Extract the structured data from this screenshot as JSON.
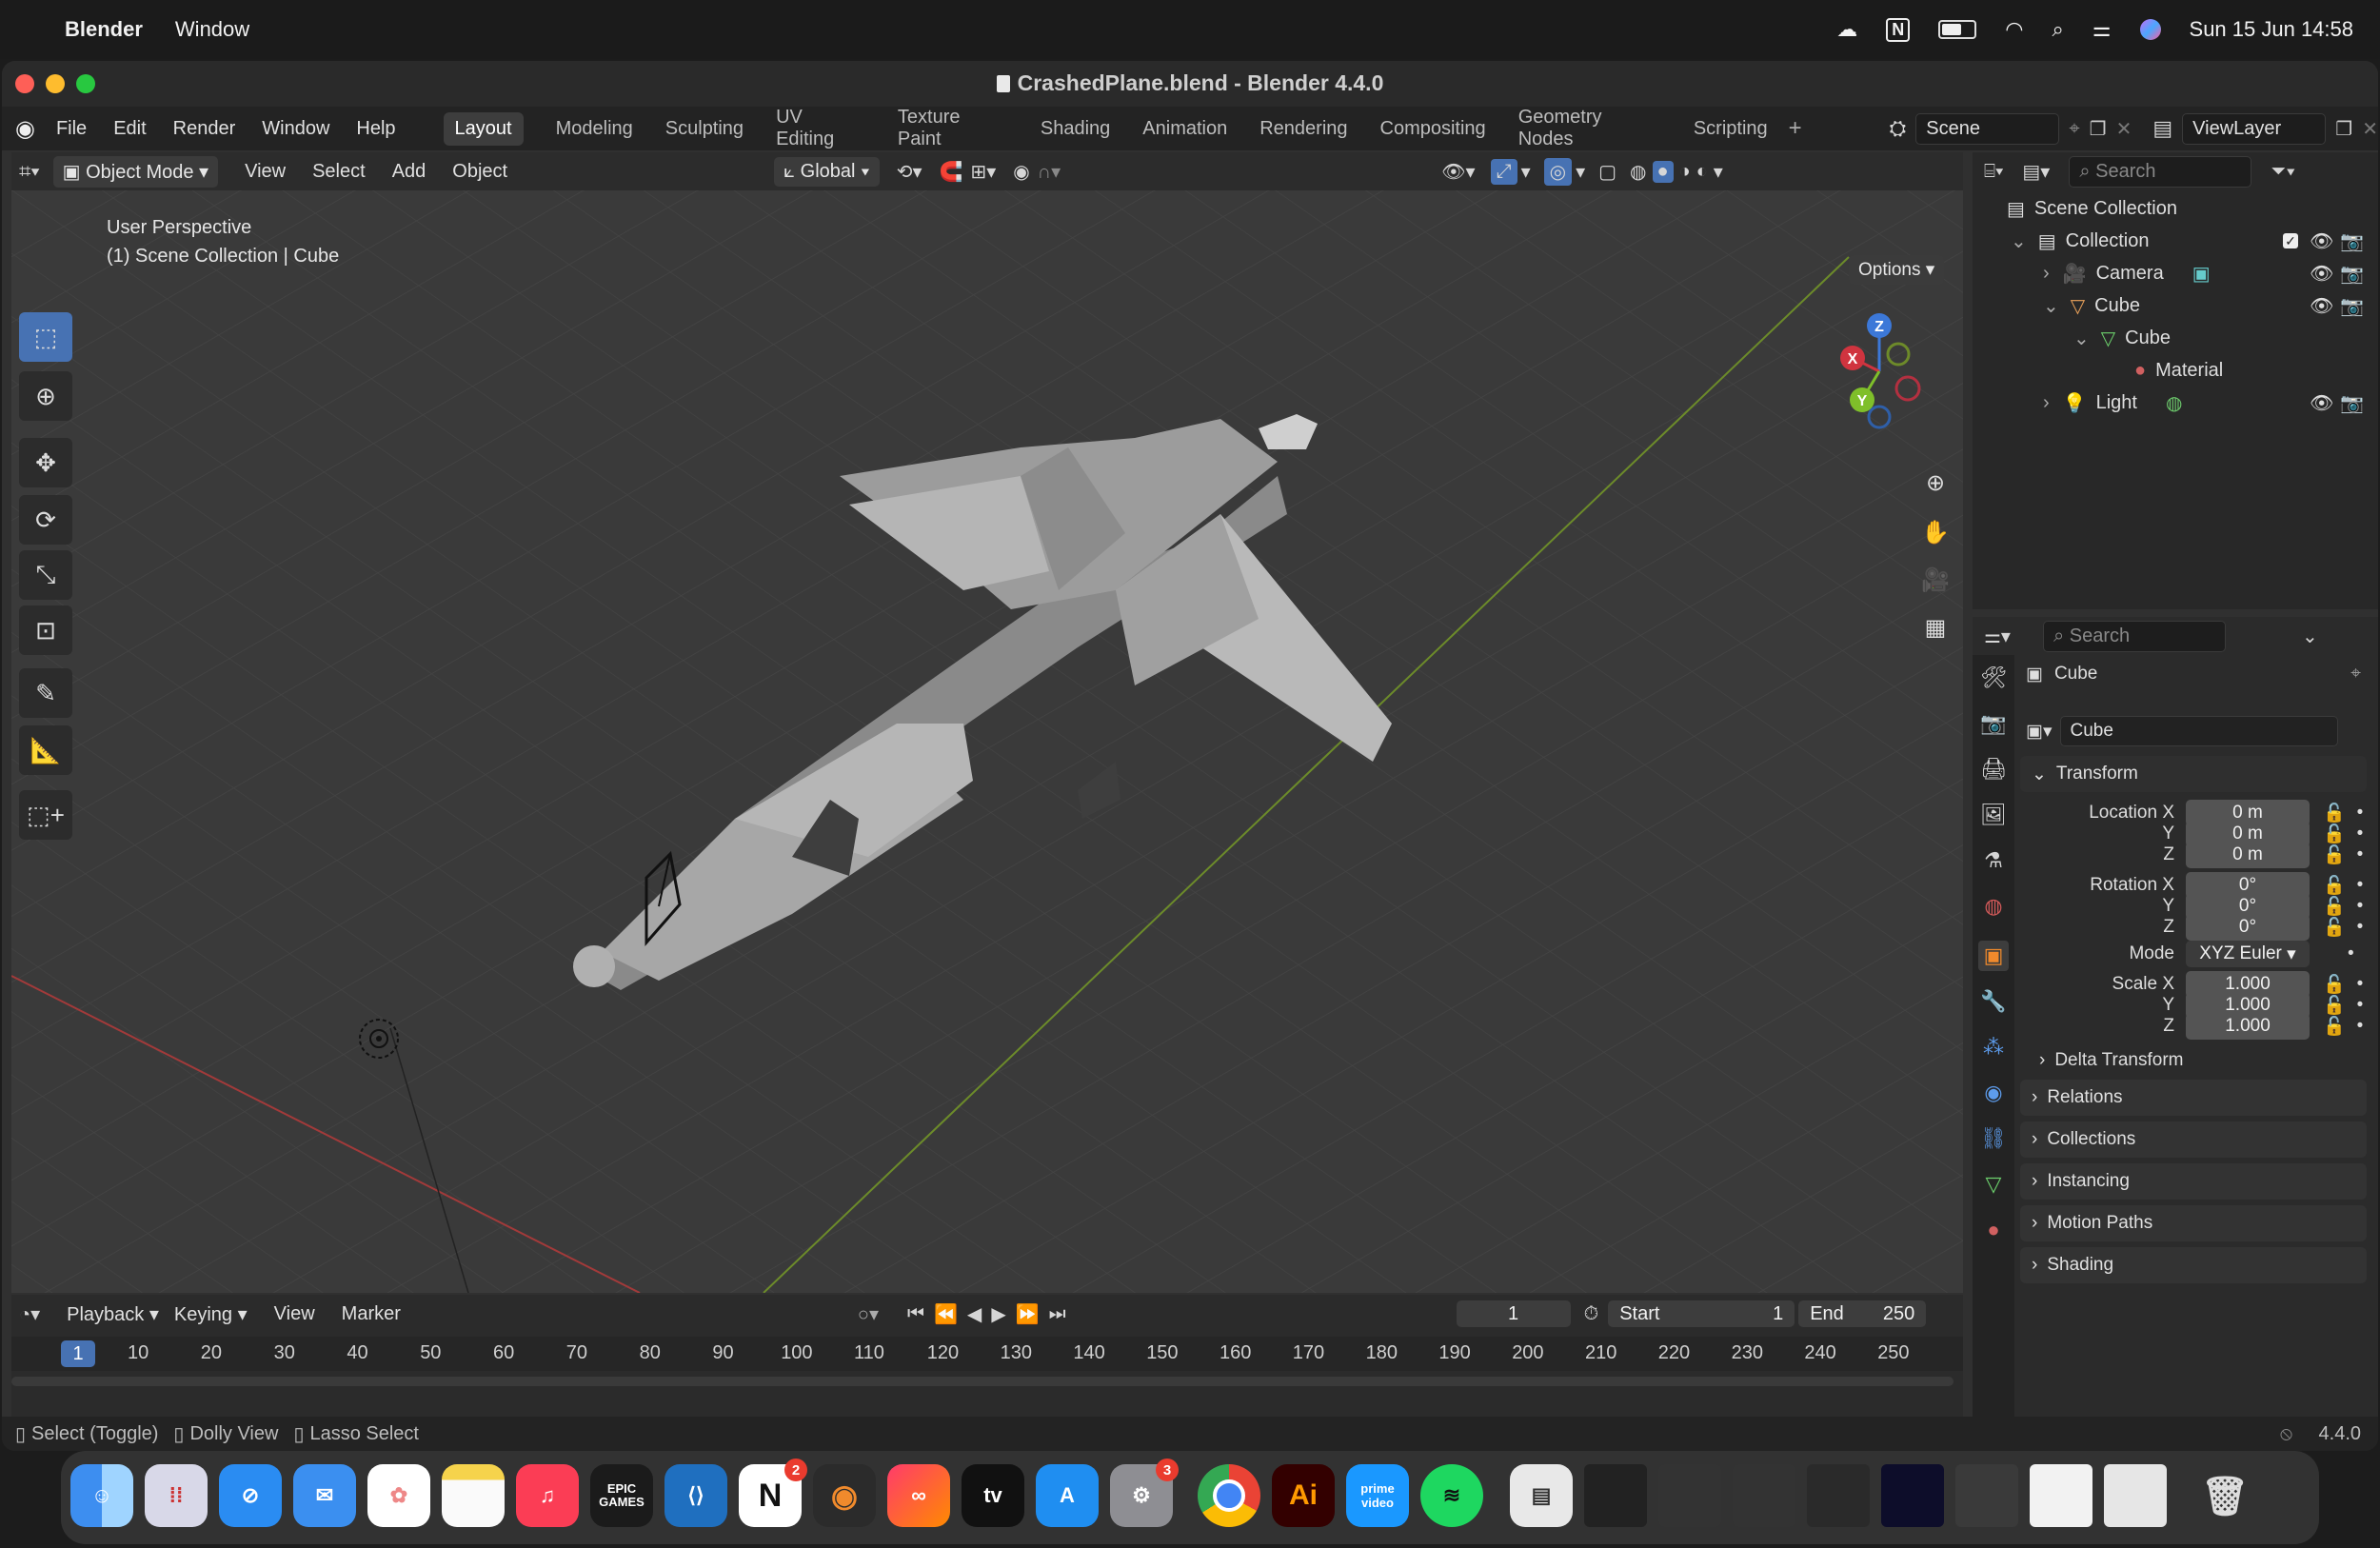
{
  "menubar": {
    "app": "Blender",
    "items": [
      "Window"
    ],
    "datetime": "Sun 15 Jun  14:58"
  },
  "window": {
    "title": "CrashedPlane.blend - Blender 4.4.0"
  },
  "topbar": {
    "menus": [
      "File",
      "Edit",
      "Render",
      "Window",
      "Help"
    ],
    "workspaces": [
      "Layout",
      "Modeling",
      "Sculpting",
      "UV Editing",
      "Texture Paint",
      "Shading",
      "Animation",
      "Rendering",
      "Compositing",
      "Geometry Nodes",
      "Scripting"
    ],
    "active_workspace": "Layout",
    "scene": "Scene",
    "view_layer": "ViewLayer"
  },
  "viewport": {
    "mode": "Object Mode",
    "menus": [
      "View",
      "Select",
      "Add",
      "Object"
    ],
    "orientation": "Global",
    "options_label": "Options",
    "overlay_line1": "User Perspective",
    "overlay_line2": "(1) Scene Collection | Cube",
    "gizmo": {
      "x": "X",
      "y": "Y",
      "z": "Z"
    }
  },
  "outliner": {
    "search_placeholder": "Search",
    "rows": [
      {
        "label": "Scene Collection"
      },
      {
        "label": "Collection"
      },
      {
        "label": "Camera"
      },
      {
        "label": "Cube"
      },
      {
        "label": "Cube"
      },
      {
        "label": "Material"
      },
      {
        "label": "Light"
      }
    ]
  },
  "properties": {
    "search_placeholder": "Search",
    "object_name": "Cube",
    "data_name": "Cube",
    "transform_label": "Transform",
    "location": {
      "label": "Location X",
      "x": "0 m",
      "y": "0 m",
      "z": "0 m"
    },
    "rotation": {
      "label": "Rotation X",
      "x": "0°",
      "y": "0°",
      "z": "0°"
    },
    "mode": {
      "label": "Mode",
      "value": "XYZ Euler"
    },
    "scale": {
      "label": "Scale X",
      "x": "1.000",
      "y": "1.000",
      "z": "1.000"
    },
    "axis_y": "Y",
    "axis_z": "Z",
    "delta_transform": "Delta Transform",
    "sections": [
      "Relations",
      "Collections",
      "Instancing",
      "Motion Paths",
      "Shading"
    ]
  },
  "timeline": {
    "menus": [
      "Playback",
      "Keying",
      "View",
      "Marker"
    ],
    "current_frame": "1",
    "start_label": "Start",
    "start": "1",
    "end_label": "End",
    "end": "250",
    "ticks": [
      "10",
      "20",
      "30",
      "40",
      "50",
      "60",
      "70",
      "80",
      "90",
      "100",
      "110",
      "120",
      "130",
      "140",
      "150",
      "160",
      "170",
      "180",
      "190",
      "200",
      "210",
      "220",
      "230",
      "240",
      "250"
    ]
  },
  "statusbar": {
    "items": [
      "Select (Toggle)",
      "Dolly View",
      "Lasso Select"
    ],
    "version": "4.4.0"
  },
  "dock": {
    "badges": {
      "notion": "2",
      "settings": "3"
    },
    "labels": {
      "epic": "EPIC GAMES",
      "tv": "tv",
      "ai": "Ai",
      "prime": "prime video"
    }
  }
}
